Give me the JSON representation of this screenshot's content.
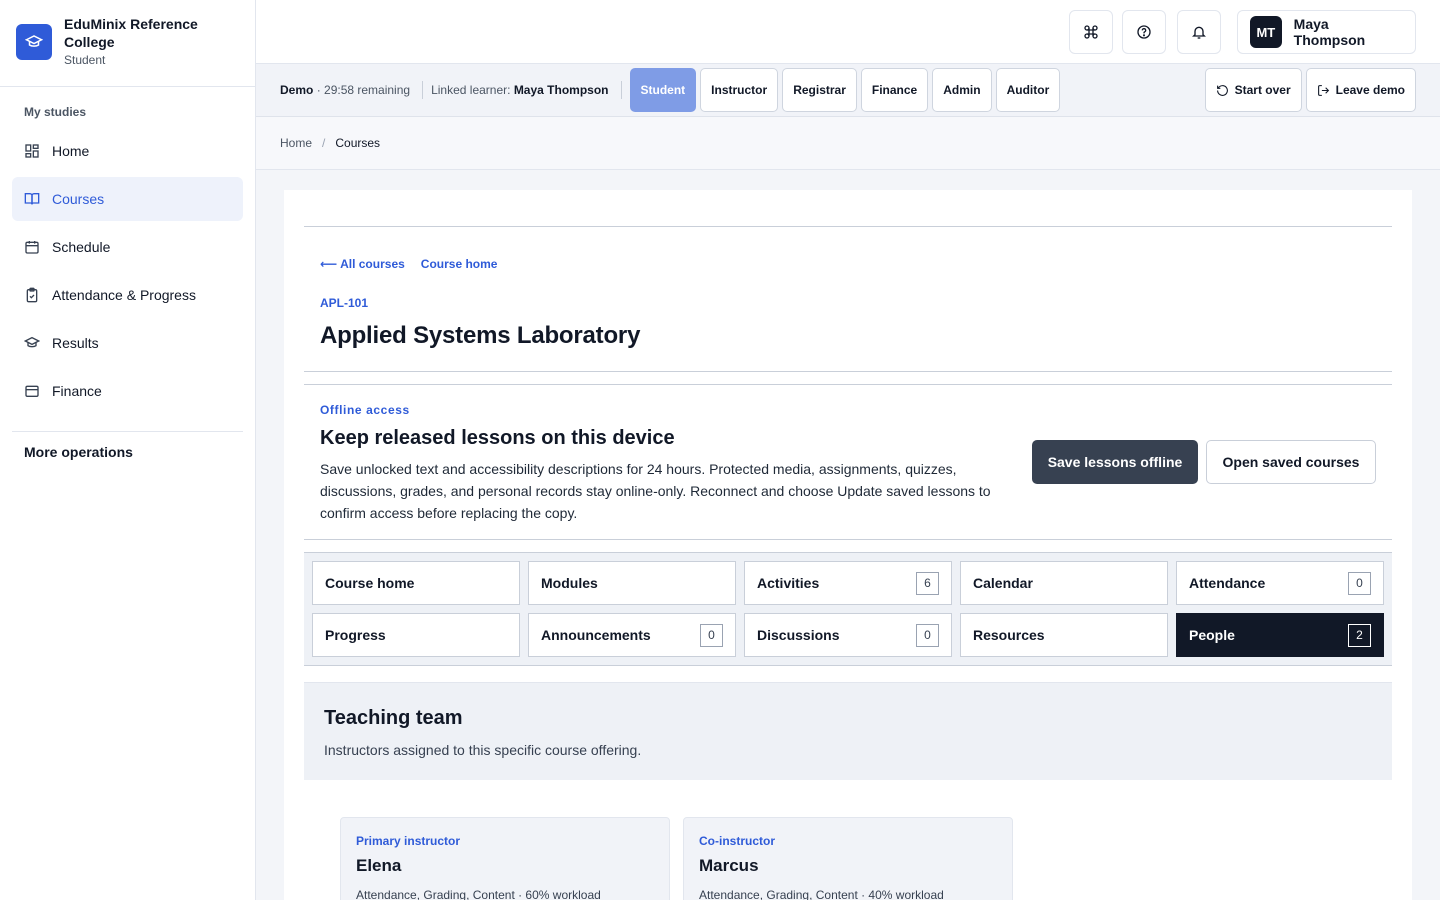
{
  "sidebar": {
    "brand_name": "EduMinix Reference College",
    "brand_role": "Student",
    "section_label": "My studies",
    "items": [
      {
        "label": "Home",
        "icon": "dashboard-icon"
      },
      {
        "label": "Courses",
        "icon": "book-icon",
        "active": true
      },
      {
        "label": "Schedule",
        "icon": "calendar-icon"
      },
      {
        "label": "Attendance & Progress",
        "icon": "clipboard-check-icon"
      },
      {
        "label": "Results",
        "icon": "graduation-cap-icon"
      },
      {
        "label": "Finance",
        "icon": "wallet-icon"
      }
    ],
    "more_operations": "More operations"
  },
  "topbar": {
    "user_initials": "MT",
    "user_name": "Maya Thompson"
  },
  "demo": {
    "label": "Demo",
    "remaining": "· 29:58 remaining",
    "linked_label": "Linked learner:",
    "linked_name": "Maya Thompson",
    "roles": [
      "Student",
      "Instructor",
      "Registrar",
      "Finance",
      "Admin",
      "Auditor"
    ],
    "active_role": "Student",
    "start_over": "Start over",
    "leave_demo": "Leave demo"
  },
  "breadcrumb": {
    "home": "Home",
    "separator": "/",
    "current": "Courses"
  },
  "course": {
    "all_courses": "⟵ All courses",
    "course_home": "Course home",
    "code": "APL-101",
    "title": "Applied Systems Laboratory"
  },
  "offline": {
    "eyebrow": "Offline access",
    "title": "Keep released lessons on this device",
    "description": "Save unlocked text and accessibility descriptions for 24 hours. Protected media, assignments, quizzes, discussions, grades, and personal records stay online-only. Reconnect and choose Update saved lessons to confirm access before replacing the copy.",
    "save_button": "Save lessons offline",
    "open_button": "Open saved courses"
  },
  "tabs": [
    {
      "label": "Course home",
      "count": ""
    },
    {
      "label": "Modules",
      "count": ""
    },
    {
      "label": "Activities",
      "count": "6"
    },
    {
      "label": "Calendar",
      "count": ""
    },
    {
      "label": "Attendance",
      "count": "0"
    },
    {
      "label": "Progress",
      "count": ""
    },
    {
      "label": "Announcements",
      "count": "0"
    },
    {
      "label": "Discussions",
      "count": "0"
    },
    {
      "label": "Resources",
      "count": ""
    },
    {
      "label": "People",
      "count": "2",
      "active": true
    }
  ],
  "team": {
    "title": "Teaching team",
    "subtitle": "Instructors assigned to this specific course offering.",
    "cards": [
      {
        "role": "Primary instructor",
        "name": "Elena",
        "meta": "Attendance, Grading, Content · 60% workload"
      },
      {
        "role": "Co-instructor",
        "name": "Marcus",
        "meta": "Attendance, Grading, Content · 40% workload"
      }
    ]
  },
  "colors": {
    "accent": "#2f5bd8",
    "active_tab": "#111827",
    "role_active": "#7f9ce6"
  }
}
